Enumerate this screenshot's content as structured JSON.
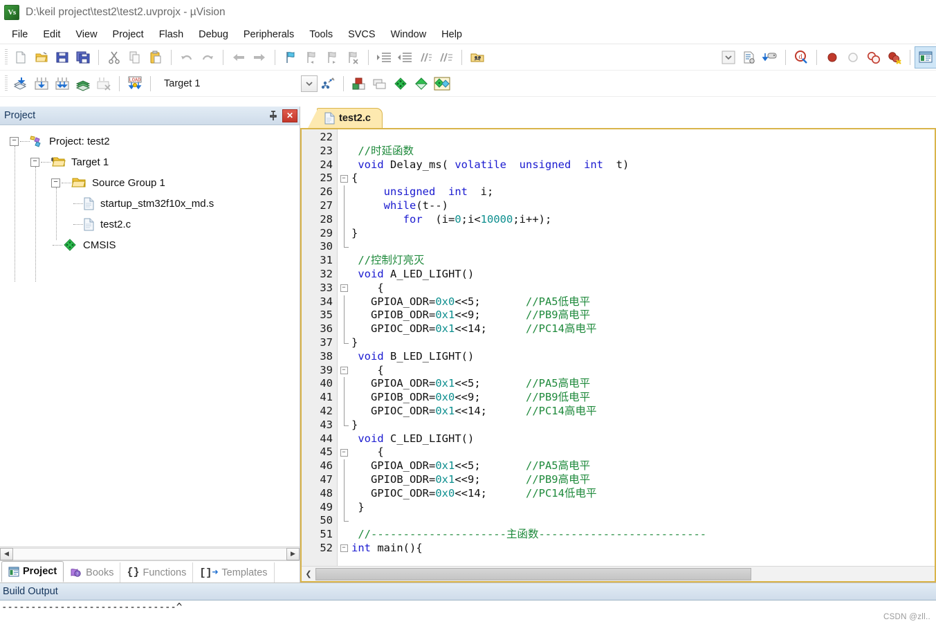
{
  "window": {
    "title": "D:\\keil project\\test2\\test2.uvprojx - µVision",
    "app_icon": "uvision-icon"
  },
  "menubar": {
    "items": [
      {
        "label": "File"
      },
      {
        "label": "Edit"
      },
      {
        "label": "View"
      },
      {
        "label": "Project"
      },
      {
        "label": "Flash"
      },
      {
        "label": "Debug"
      },
      {
        "label": "Peripherals"
      },
      {
        "label": "Tools"
      },
      {
        "label": "SVCS"
      },
      {
        "label": "Window"
      },
      {
        "label": "Help"
      }
    ]
  },
  "toolbar_main": {
    "buttons": [
      {
        "name": "new-file-icon",
        "title": "New"
      },
      {
        "name": "open-file-icon",
        "title": "Open"
      },
      {
        "name": "save-icon",
        "title": "Save"
      },
      {
        "name": "save-all-icon",
        "title": "Save All"
      },
      {
        "name": "cut-icon",
        "title": "Cut"
      },
      {
        "name": "copy-icon",
        "title": "Copy"
      },
      {
        "name": "paste-icon",
        "title": "Paste"
      },
      {
        "name": "undo-icon",
        "title": "Undo"
      },
      {
        "name": "redo-icon",
        "title": "Redo"
      },
      {
        "name": "navigate-back-icon",
        "title": "Back"
      },
      {
        "name": "navigate-forward-icon",
        "title": "Forward"
      },
      {
        "name": "bookmark-toggle-icon",
        "title": "Insert/Remove Bookmark"
      },
      {
        "name": "bookmark-prev-icon",
        "title": "Previous Bookmark"
      },
      {
        "name": "bookmark-next-icon",
        "title": "Next Bookmark"
      },
      {
        "name": "bookmark-clear-icon",
        "title": "Clear All Bookmarks"
      },
      {
        "name": "indent-icon",
        "title": "Indent"
      },
      {
        "name": "outdent-icon",
        "title": "Outdent"
      },
      {
        "name": "comment-icon",
        "title": "Comment"
      },
      {
        "name": "uncomment-icon",
        "title": "Uncomment"
      },
      {
        "name": "find-in-files-icon",
        "title": "Find in Files"
      },
      {
        "name": "config-dropdown-icon",
        "title": "Configure"
      },
      {
        "name": "text-config-icon",
        "title": "Configuration"
      },
      {
        "name": "debug-settings-icon",
        "title": "Debug Settings"
      },
      {
        "name": "start-debug-icon",
        "title": "Start/Stop Debug Session"
      },
      {
        "name": "breakpoint-insert-icon",
        "title": "Insert/Remove Breakpoint"
      },
      {
        "name": "breakpoint-disable-icon",
        "title": "Enable/Disable Breakpoint"
      },
      {
        "name": "breakpoint-disable-all-icon",
        "title": "Disable All Breakpoints"
      },
      {
        "name": "breakpoint-kill-all-icon",
        "title": "Kill All Breakpoints"
      },
      {
        "name": "project-window-icon",
        "title": "Project Window"
      }
    ]
  },
  "toolbar_build": {
    "buttons": [
      {
        "name": "translate-icon",
        "title": "Translate"
      },
      {
        "name": "build-icon",
        "title": "Build"
      },
      {
        "name": "rebuild-icon",
        "title": "Rebuild"
      },
      {
        "name": "batch-build-icon",
        "title": "Batch Build"
      },
      {
        "name": "stop-build-icon",
        "title": "Stop Build"
      },
      {
        "name": "download-icon",
        "title": "Download"
      }
    ],
    "target_value": "Target 1",
    "after_buttons": [
      {
        "name": "target-options-icon",
        "title": "Options for Target"
      },
      {
        "name": "manage-wizard-icon",
        "title": "Manage Run-Time Environment"
      },
      {
        "name": "components-icon",
        "title": "Manage Project Items"
      },
      {
        "name": "multi-project-icon",
        "title": "Multi-Project"
      },
      {
        "name": "pack-installer-icon",
        "title": "Pack Installer"
      },
      {
        "name": "pack-green-icon",
        "title": "Packs"
      },
      {
        "name": "pack-multi-icon",
        "title": "Select Software Packs"
      }
    ]
  },
  "project_panel": {
    "header_title": "Project",
    "pin_icon": "pin-icon",
    "close_icon": "close-icon",
    "tree": [
      {
        "label": "Project: test2",
        "icon": "project-icon",
        "depth": 0,
        "expander": "-"
      },
      {
        "label": "Target 1",
        "icon": "target-folder-icon",
        "depth": 1,
        "expander": "-"
      },
      {
        "label": "Source Group 1",
        "icon": "folder-icon",
        "depth": 2,
        "expander": "-"
      },
      {
        "label": "startup_stm32f10x_md.s",
        "icon": "file-icon",
        "depth": 3,
        "expander": ""
      },
      {
        "label": "test2.c",
        "icon": "file-icon",
        "depth": 3,
        "expander": ""
      },
      {
        "label": "CMSIS",
        "icon": "cmsis-icon",
        "depth": 2,
        "expander": ""
      }
    ],
    "tabs": [
      {
        "label": "Project",
        "icon": "project-tab-icon",
        "selected": true
      },
      {
        "label": "Books",
        "icon": "books-icon",
        "selected": false
      },
      {
        "label": "Functions",
        "icon": "functions-icon",
        "selected": false
      },
      {
        "label": "Templates",
        "icon": "templates-icon",
        "selected": false
      }
    ]
  },
  "editor": {
    "tab": {
      "label": "test2.c",
      "icon": "c-file-icon",
      "selected": true
    },
    "first_line_number": 22,
    "lines": [
      {
        "n": 22,
        "fold": "",
        "tokens": []
      },
      {
        "n": 23,
        "fold": "",
        "tokens": [
          {
            "t": "pln",
            "s": " "
          },
          {
            "t": "cmt",
            "s": "//时延函数"
          }
        ]
      },
      {
        "n": 24,
        "fold": "",
        "tokens": [
          {
            "t": "pln",
            "s": " "
          },
          {
            "t": "kw",
            "s": "void"
          },
          {
            "t": "pln",
            "s": " Delay_ms( "
          },
          {
            "t": "kw",
            "s": "volatile"
          },
          {
            "t": "pln",
            "s": "  "
          },
          {
            "t": "kw",
            "s": "unsigned"
          },
          {
            "t": "pln",
            "s": "  "
          },
          {
            "t": "kw",
            "s": "int"
          },
          {
            "t": "pln",
            "s": "  t)"
          }
        ]
      },
      {
        "n": 25,
        "fold": "box",
        "tokens": [
          {
            "t": "pln",
            "s": "{"
          }
        ]
      },
      {
        "n": 26,
        "fold": "line",
        "tokens": [
          {
            "t": "pln",
            "s": "     "
          },
          {
            "t": "kw",
            "s": "unsigned"
          },
          {
            "t": "pln",
            "s": "  "
          },
          {
            "t": "kw",
            "s": "int"
          },
          {
            "t": "pln",
            "s": "  i;"
          }
        ]
      },
      {
        "n": 27,
        "fold": "line",
        "tokens": [
          {
            "t": "pln",
            "s": "     "
          },
          {
            "t": "kw",
            "s": "while"
          },
          {
            "t": "pln",
            "s": "(t--)"
          }
        ]
      },
      {
        "n": 28,
        "fold": "line",
        "tokens": [
          {
            "t": "pln",
            "s": "        "
          },
          {
            "t": "kw",
            "s": "for"
          },
          {
            "t": "pln",
            "s": "  (i="
          },
          {
            "t": "num",
            "s": "0"
          },
          {
            "t": "pln",
            "s": ";i<"
          },
          {
            "t": "num",
            "s": "10000"
          },
          {
            "t": "pln",
            "s": ";i++);"
          }
        ]
      },
      {
        "n": 29,
        "fold": "line",
        "tokens": [
          {
            "t": "pln",
            "s": "}"
          }
        ]
      },
      {
        "n": 30,
        "fold": "end",
        "tokens": []
      },
      {
        "n": 31,
        "fold": "",
        "tokens": [
          {
            "t": "pln",
            "s": " "
          },
          {
            "t": "cmt",
            "s": "//控制灯亮灭"
          }
        ]
      },
      {
        "n": 32,
        "fold": "",
        "tokens": [
          {
            "t": "pln",
            "s": " "
          },
          {
            "t": "kw",
            "s": "void"
          },
          {
            "t": "pln",
            "s": " A_LED_LIGHT()"
          }
        ]
      },
      {
        "n": 33,
        "fold": "box",
        "tokens": [
          {
            "t": "pln",
            "s": "    {"
          }
        ]
      },
      {
        "n": 34,
        "fold": "line",
        "tokens": [
          {
            "t": "pln",
            "s": "   GPIOA_ODR="
          },
          {
            "t": "num",
            "s": "0x0"
          },
          {
            "t": "pln",
            "s": "<<5;       "
          },
          {
            "t": "cmt",
            "s": "//PA5低电平"
          }
        ]
      },
      {
        "n": 35,
        "fold": "line",
        "tokens": [
          {
            "t": "pln",
            "s": "   GPIOB_ODR="
          },
          {
            "t": "num",
            "s": "0x1"
          },
          {
            "t": "pln",
            "s": "<<9;       "
          },
          {
            "t": "cmt",
            "s": "//PB9高电平"
          }
        ]
      },
      {
        "n": 36,
        "fold": "line",
        "tokens": [
          {
            "t": "pln",
            "s": "   GPIOC_ODR="
          },
          {
            "t": "num",
            "s": "0x1"
          },
          {
            "t": "pln",
            "s": "<<14;      "
          },
          {
            "t": "cmt",
            "s": "//PC14高电平"
          }
        ]
      },
      {
        "n": 37,
        "fold": "end",
        "tokens": [
          {
            "t": "pln",
            "s": "}"
          }
        ]
      },
      {
        "n": 38,
        "fold": "",
        "tokens": [
          {
            "t": "pln",
            "s": " "
          },
          {
            "t": "kw",
            "s": "void"
          },
          {
            "t": "pln",
            "s": " B_LED_LIGHT()"
          }
        ]
      },
      {
        "n": 39,
        "fold": "box",
        "tokens": [
          {
            "t": "pln",
            "s": "    {"
          }
        ]
      },
      {
        "n": 40,
        "fold": "line",
        "tokens": [
          {
            "t": "pln",
            "s": "   GPIOA_ODR="
          },
          {
            "t": "num",
            "s": "0x1"
          },
          {
            "t": "pln",
            "s": "<<5;       "
          },
          {
            "t": "cmt",
            "s": "//PA5高电平"
          }
        ]
      },
      {
        "n": 41,
        "fold": "line",
        "tokens": [
          {
            "t": "pln",
            "s": "   GPIOB_ODR="
          },
          {
            "t": "num",
            "s": "0x0"
          },
          {
            "t": "pln",
            "s": "<<9;       "
          },
          {
            "t": "cmt",
            "s": "//PB9低电平"
          }
        ]
      },
      {
        "n": 42,
        "fold": "line",
        "tokens": [
          {
            "t": "pln",
            "s": "   GPIOC_ODR="
          },
          {
            "t": "num",
            "s": "0x1"
          },
          {
            "t": "pln",
            "s": "<<14;      "
          },
          {
            "t": "cmt",
            "s": "//PC14高电平"
          }
        ]
      },
      {
        "n": 43,
        "fold": "end",
        "tokens": [
          {
            "t": "pln",
            "s": "}"
          }
        ]
      },
      {
        "n": 44,
        "fold": "",
        "tokens": [
          {
            "t": "pln",
            "s": " "
          },
          {
            "t": "kw",
            "s": "void"
          },
          {
            "t": "pln",
            "s": " C_LED_LIGHT()"
          }
        ]
      },
      {
        "n": 45,
        "fold": "box",
        "tokens": [
          {
            "t": "pln",
            "s": "    {"
          }
        ]
      },
      {
        "n": 46,
        "fold": "line",
        "tokens": [
          {
            "t": "pln",
            "s": "   GPIOA_ODR="
          },
          {
            "t": "num",
            "s": "0x1"
          },
          {
            "t": "pln",
            "s": "<<5;       "
          },
          {
            "t": "cmt",
            "s": "//PA5高电平"
          }
        ]
      },
      {
        "n": 47,
        "fold": "line",
        "tokens": [
          {
            "t": "pln",
            "s": "   GPIOB_ODR="
          },
          {
            "t": "num",
            "s": "0x1"
          },
          {
            "t": "pln",
            "s": "<<9;       "
          },
          {
            "t": "cmt",
            "s": "//PB9高电平"
          }
        ]
      },
      {
        "n": 48,
        "fold": "line",
        "tokens": [
          {
            "t": "pln",
            "s": "   GPIOC_ODR="
          },
          {
            "t": "num",
            "s": "0x0"
          },
          {
            "t": "pln",
            "s": "<<14;      "
          },
          {
            "t": "cmt",
            "s": "//PC14低电平"
          }
        ]
      },
      {
        "n": 49,
        "fold": "line",
        "tokens": [
          {
            "t": "pln",
            "s": " }"
          }
        ]
      },
      {
        "n": 50,
        "fold": "end",
        "tokens": []
      },
      {
        "n": 51,
        "fold": "",
        "tokens": [
          {
            "t": "pln",
            "s": " "
          },
          {
            "t": "cmt",
            "s": "//---------------------主函数--------------------------"
          }
        ]
      },
      {
        "n": 52,
        "fold": "box",
        "tokens": [
          {
            "t": "kw",
            "s": "int"
          },
          {
            "t": "pln",
            "s": " main(){"
          }
        ]
      }
    ]
  },
  "build_output": {
    "title": "Build Output",
    "text": "------------------------------^"
  },
  "watermark": {
    "text": "CSDN @zll.."
  },
  "colors": {
    "tab_yellow": "#fde9b0",
    "tab_border": "#d9b44a",
    "panel_header": "#cfdcea",
    "keyword": "#1a1ad0",
    "comment": "#1f8a3c",
    "number": "#0e8f8f",
    "close_red": "#c3372a"
  }
}
